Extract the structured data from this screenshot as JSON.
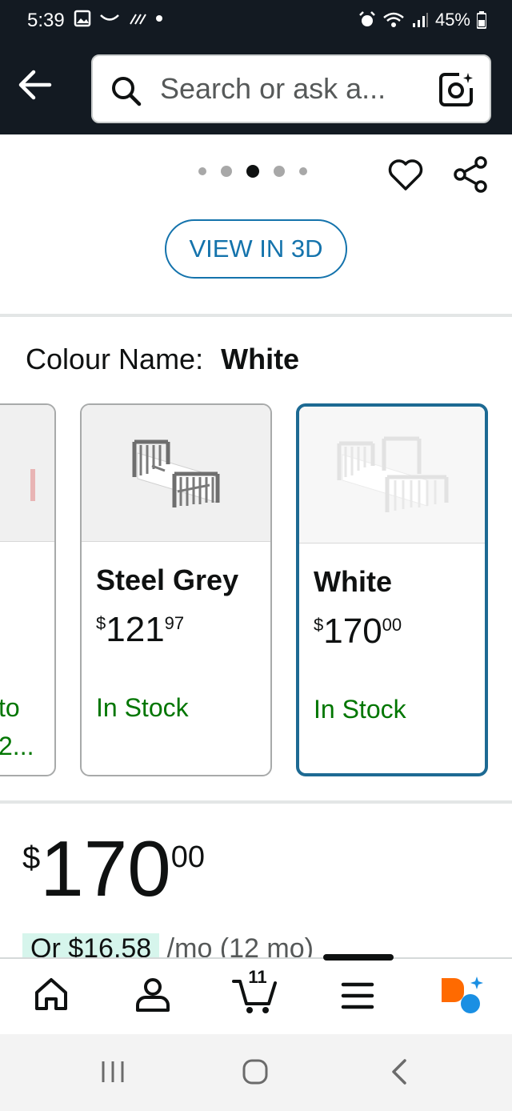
{
  "status_bar": {
    "time": "5:39",
    "battery": "45%"
  },
  "search": {
    "placeholder": "Search or ask a..."
  },
  "gallery": {
    "dot_count": 5,
    "active_dot": 3
  },
  "view_3d_label": "VIEW IN 3D",
  "colour": {
    "label": "Colour Name:",
    "selected": "White"
  },
  "swatches": [
    {
      "name": "",
      "stock_line1": "to",
      "stock_line2": "2..."
    },
    {
      "name": "Steel Grey",
      "price_dollar": "$",
      "price_whole": "121",
      "price_cents": "97",
      "stock": "In Stock"
    },
    {
      "name": "White",
      "price_dollar": "$",
      "price_whole": "170",
      "price_cents": "00",
      "stock": "In Stock"
    }
  ],
  "price": {
    "currency": "$",
    "whole": "170",
    "cents": "00"
  },
  "monthly": {
    "amount": "Or $16.58",
    "term": "/mo (12 mo)"
  },
  "bottom_nav": {
    "cart_count": "11"
  },
  "colors": {
    "header_bg": "#131a22",
    "accent_blue": "#1473ac",
    "in_stock_green": "#007600",
    "selected_border": "#1d6a93"
  }
}
